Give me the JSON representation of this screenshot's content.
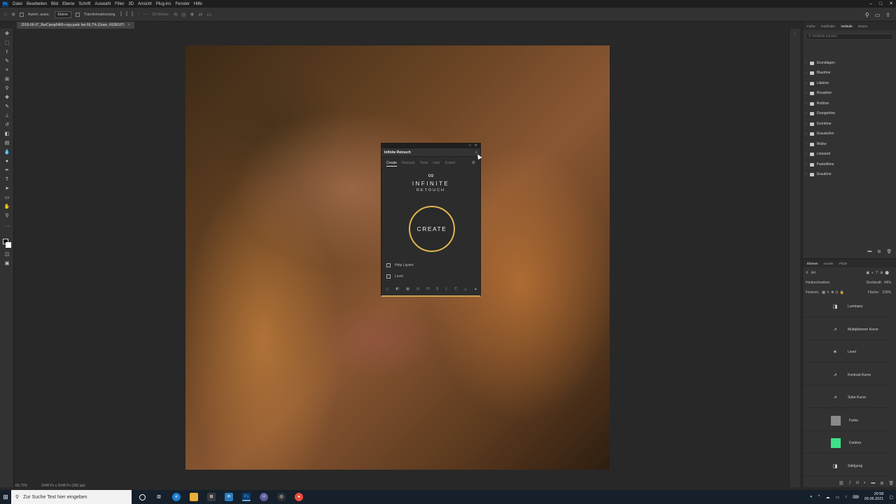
{
  "menubar": {
    "items": [
      "Datei",
      "Bearbeiten",
      "Bild",
      "Ebene",
      "Schrift",
      "Auswahl",
      "Filter",
      "3D",
      "Ansicht",
      "Plug-ins",
      "Fenster",
      "Hilfe"
    ]
  },
  "options": {
    "autoselect": "Autom. ausw.:",
    "layer_select": "Ebene",
    "transform": "Transformationsstrg.",
    "mode3d": "3D-Modus:"
  },
  "document": {
    "tab_title": "2018-06-07_BarCamp0466-copy.psdc bei 66,7% (Grain, RGB/16*)",
    "zoom": "66,73%",
    "size": "2048 Px x 2048 Px (300 ppi)"
  },
  "plugin": {
    "header_title": "Infinite Retouch",
    "tabs": [
      "Create",
      "Retouch",
      "Tools",
      "User",
      "Export"
    ],
    "active_tab": "Create",
    "brand": "INFINITE",
    "brand_sub": "RETOUCH",
    "create_label": "CREATE",
    "checkbox1": "Help Layers",
    "checkbox2": "Level",
    "bottom_letters": [
      "H",
      "S",
      "L",
      "C"
    ]
  },
  "right_panel": {
    "tabs": [
      "Farbe",
      "Farbfelder",
      "Verläufe",
      "Muster"
    ],
    "active_tab": "Verläufe",
    "search_placeholder": "Verläufe suchen",
    "folders": [
      "Grundlagen",
      "Blautöne",
      "Lilatöne",
      "Rosatöne",
      "Rottöne",
      "Orangetöne",
      "Grüntöne",
      "Graustufen",
      "Wolke",
      "Lineared",
      "Pastelltöne",
      "Grautöne"
    ]
  },
  "layers": {
    "tabs": [
      "Ebenen",
      "Kanäle",
      "Pfade"
    ],
    "active_tab": "Ebenen",
    "filter": "Art",
    "blend_mode": "Hindurchwirken",
    "opacity_label": "Deckkraft:",
    "opacity_value": "44%",
    "lock_label": "Fixieren:",
    "fill_label": "Fläche:",
    "fill_value": "100%",
    "items": [
      {
        "name": "Luminanz",
        "icon": "mask-icon"
      },
      {
        "name": "Multiplizieren Kurve",
        "icon": "curves-icon"
      },
      {
        "name": "Level",
        "icon": "brightness-icon"
      },
      {
        "name": "Kontrast Kurve",
        "icon": "curves-icon"
      },
      {
        "name": "Solar Kurve",
        "icon": "curves-icon"
      },
      {
        "name": "Farbe",
        "icon": "color-swatch-gray"
      },
      {
        "name": "Farbton",
        "icon": "color-swatch-green"
      },
      {
        "name": "Sättigung",
        "icon": "mask-icon"
      }
    ],
    "swatch_gray": "#8a8a8a",
    "swatch_green": "#3ee08a"
  },
  "taskbar": {
    "search_placeholder": "Zur Suche Text hier eingeben",
    "time": "20:58",
    "date": "09.06.2021"
  },
  "colors": {
    "accent_gold": "#e0b64d",
    "ps_blue": "#31a8ff"
  }
}
